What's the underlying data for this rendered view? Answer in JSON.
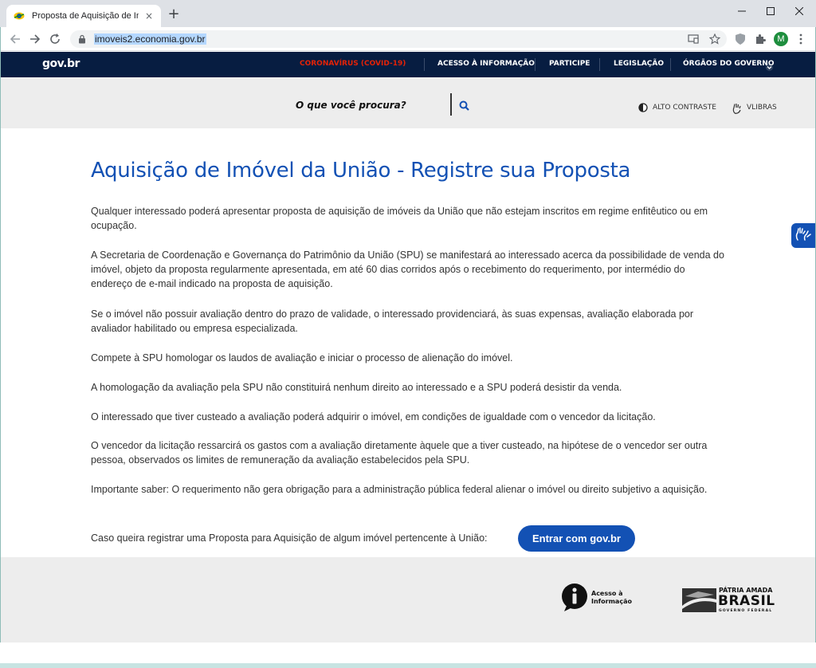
{
  "browser": {
    "tab_title": "Proposta de Aquisição de Imóvel",
    "tab_close": "×",
    "new_tab": "+",
    "url": "imoveis2.economia.gov.br",
    "profile_initial": "M",
    "win_minimize": "–",
    "win_maximize": "☐",
    "win_close": "✕"
  },
  "govbar": {
    "logo": "gov.br",
    "nav": [
      {
        "label": "CORONAVÍRUS (COVID-19)"
      },
      {
        "label": "ACESSO À INFORMAÇÃO"
      },
      {
        "label": "PARTICIPE"
      },
      {
        "label": "LEGISLAÇÃO"
      },
      {
        "label": "ÓRGÃOS DO GOVERNO"
      }
    ]
  },
  "header": {
    "search_placeholder": "O que você procura?",
    "alto_contraste": "ALTO CONTRASTE",
    "vlibras": "VLIBRAS"
  },
  "main": {
    "title": "Aquisição de Imóvel da União - Registre sua Proposta",
    "paragraphs": [
      "Qualquer interessado poderá apresentar proposta de aquisição de imóveis da União que não estejam inscritos em regime enfitêutico ou em ocupação.",
      "A Secretaria de Coordenação e Governança do Patrimônio da União (SPU) se manifestará ao interessado acerca da possibilidade de venda do imóvel, objeto da proposta regularmente apresentada, em até 60 dias corridos após o recebimento do requerimento, por intermédio do endereço de e-mail indicado na proposta de aquisição.",
      "Se o imóvel não possuir avaliação dentro do prazo de validade, o interessado providenciará, às suas expensas, avaliação elaborada por avaliador habilitado ou empresa especializada.",
      "Compete à SPU homologar os laudos de avaliação e iniciar o processo de alienação do imóvel.",
      "A homologação da avaliação pela SPU não constituirá nenhum direito ao interessado e a SPU poderá desistir da venda.",
      "O interessado que tiver custeado a avaliação poderá adquirir o imóvel, em condições de igualdade com o vencedor da licitação.",
      "O vencedor da licitação ressarcirá os gastos com a avaliação diretamente àquele que a tiver custeado, na hipótese de o vencedor ser outra pessoa, observados os limites de remuneração da avaliação estabelecidos pela SPU.",
      "Importante saber: O requerimento não gera obrigação para a administração pública federal alienar o imóvel ou direito subjetivo a aquisição."
    ],
    "cta_text": "Caso queira registrar uma Proposta para Aquisição de algum imóvel pertencente à União:",
    "cta_button": "Entrar com gov.br"
  },
  "footer": {
    "acesso_line1": "Acesso à",
    "acesso_line2": "Informação",
    "patria_line1": "PÁTRIA AMADA",
    "patria_line2": "BRASIL",
    "patria_line3": "GOVERNO FEDERAL"
  },
  "colors": {
    "gov_blue_dark": "#071d41",
    "gov_blue": "#1351b4",
    "covid_red": "#e52207",
    "header_gray": "#ededed"
  }
}
